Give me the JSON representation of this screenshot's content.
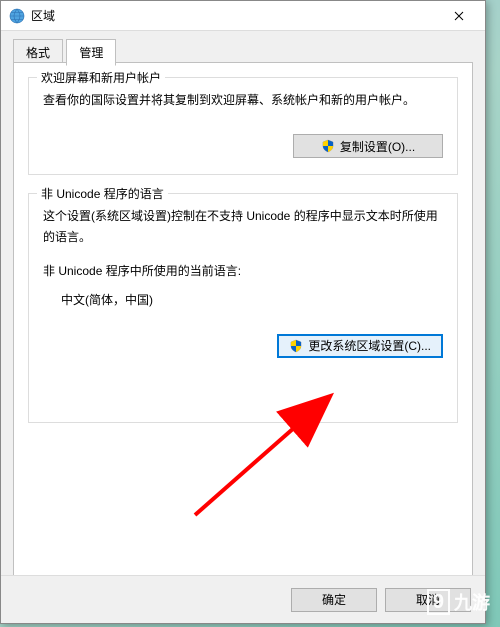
{
  "titlebar": {
    "title": "区域"
  },
  "tabs": {
    "format": "格式",
    "admin": "管理"
  },
  "group1": {
    "legend": "欢迎屏幕和新用户帐户",
    "desc": "查看你的国际设置并将其复制到欢迎屏幕、系统帐户和新的用户帐户。",
    "copy_btn": "复制设置(O)..."
  },
  "group2": {
    "legend": "非 Unicode 程序的语言",
    "desc": "这个设置(系统区域设置)控制在不支持 Unicode 的程序中显示文本时所使用的语言。",
    "current_label": "非 Unicode 程序中所使用的当前语言:",
    "current_value": "中文(简体，中国)",
    "change_btn": "更改系统区域设置(C)..."
  },
  "footer": {
    "ok": "确定",
    "cancel": "取消"
  },
  "watermark": {
    "brand": "九游"
  }
}
